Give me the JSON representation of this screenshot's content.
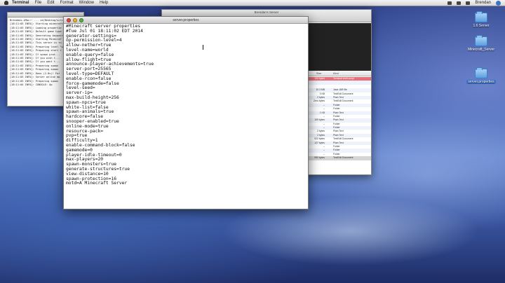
{
  "menubar": {
    "items": [
      "Terminal",
      "File",
      "Edit",
      "Format",
      "Window",
      "Help"
    ],
    "clock": "Brendan"
  },
  "desktop": {
    "icons": [
      {
        "label": "1.6 Server",
        "selected": false
      },
      {
        "label": "Minecraft_Server",
        "selected": false
      },
      {
        "label": "server.properties",
        "selected": true
      }
    ]
  },
  "terminal": {
    "lines": [
      "Brendans-iMac:~ ... cd/Desktop/scrip",
      "[18:11:03 INFO]: Starting minecraft",
      "[18:11:03 INFO]: Loading propertie",
      "[18:11:03 INFO]: Default game type",
      "[18:11:03 INFO]: Generating keypair",
      "[18:11:03 INFO]: Starting Minecraf",
      "[18:11:03 INFO]: This server is ru",
      "[18:11:03 INFO]: Preparing level \"w",
      "[18:11:03 INFO]: Preparing start r",
      "[18:11:03 INFO]: If spawn prot...",
      "[18:11:03 INFO]: If you wish t...",
      "[18:11:03 INFO]: If you want t...",
      "[18:11:03 INFO]: Preparing spawn",
      "[18:11:03 INFO]: Preparing spawn",
      "[18:11:03 INFO]: Done (2.8s)! For",
      "[18:11:03 INFO]: Server online mo",
      "[18:11:03 INFO]: Preparing spawn",
      "[18:11:04 INFO]: CONSOLE: Op"
    ]
  },
  "finder": {
    "title": "Brendan's Server",
    "columns": {
      "size": "Size",
      "kind": "Kind"
    },
    "rows": [
      {
        "size": "134 bytes",
        "kind": "Terminal shell script",
        "state": "hl"
      },
      {
        "size": "",
        "kind": "",
        "state": ""
      },
      {
        "size": "",
        "kind": "",
        "state": ""
      },
      {
        "size": "10.3 MB",
        "kind": "Java JAR file",
        "state": ""
      },
      {
        "size": "3 KB",
        "kind": "TextEdit Document",
        "state": ""
      },
      {
        "size": "2 bytes",
        "kind": "Plain Text",
        "state": ""
      },
      {
        "size": "Zero bytes",
        "kind": "TextEdit Document",
        "state": ""
      },
      {
        "size": "--",
        "kind": "Folder",
        "state": ""
      },
      {
        "size": "--",
        "kind": "Folder",
        "state": ""
      },
      {
        "size": "1 KB",
        "kind": "Plain Text",
        "state": ""
      },
      {
        "size": "--",
        "kind": "Folder",
        "state": ""
      },
      {
        "size": "109 bytes",
        "kind": "Plain Text",
        "state": ""
      },
      {
        "size": "--",
        "kind": "Folder",
        "state": ""
      },
      {
        "size": "--",
        "kind": "Folder",
        "state": ""
      },
      {
        "size": "2 bytes",
        "kind": "Plain Text",
        "state": ""
      },
      {
        "size": "2 bytes",
        "kind": "Plain Text",
        "state": ""
      },
      {
        "size": "922 bytes",
        "kind": "TextEdit Document",
        "state": ""
      },
      {
        "size": "127 bytes",
        "kind": "Plain Text",
        "state": ""
      },
      {
        "size": "--",
        "kind": "Folder",
        "state": ""
      },
      {
        "size": "--",
        "kind": "Folder",
        "state": ""
      },
      {
        "size": "--",
        "kind": "Folder",
        "state": ""
      },
      {
        "size": "950 bytes",
        "kind": "TextEdit Document",
        "state": "sel"
      }
    ]
  },
  "editor": {
    "title": "server.properties",
    "lines": [
      "#Minecraft server properties",
      "#Tue Jul 01 18:11:02 EDT 2014",
      "generator-settings=",
      "op-permission-level=4",
      "allow-nether=true",
      "level-name=world",
      "enable-query=false",
      "allow-flight=true",
      "announce-player-achievements=true",
      "server-port=25565",
      "level-type=DEFAULT",
      "enable-rcon=false",
      "force-gamemode=false",
      "level-seed=",
      "server-ip=",
      "max-build-height=256",
      "spawn-npcs=true",
      "white-list=false",
      "spawn-animals=true",
      "hardcore=false",
      "snooper-enabled=true",
      "online-mode=true",
      "resource-pack=",
      "pvp=true",
      "difficulty=1",
      "enable-command-block=false",
      "gamemode=0",
      "player-idle-timeout=0",
      "max-players=20",
      "spawn-monsters=true",
      "generate-structures=true",
      "view-distance=10",
      "spawn-protection=16",
      "motd=A Minecraft Server"
    ]
  }
}
